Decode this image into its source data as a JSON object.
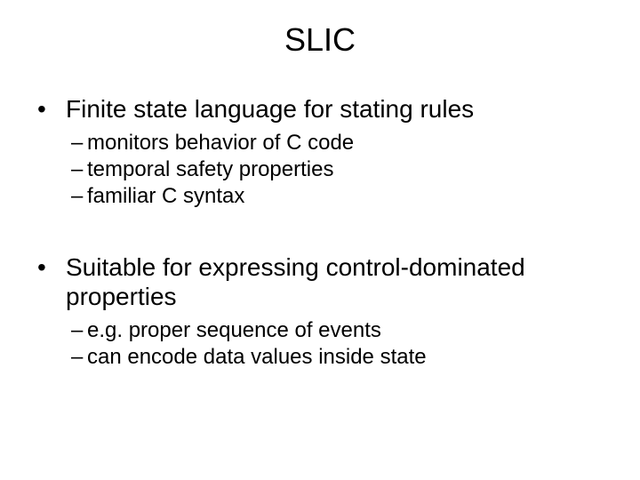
{
  "slide": {
    "title": "SLIC",
    "groups": [
      {
        "heading": "Finite state language for stating rules",
        "items": [
          "monitors behavior of C code",
          "temporal safety properties",
          "familiar C syntax"
        ]
      },
      {
        "heading": "Suitable for expressing control-dominated properties",
        "items": [
          "e.g. proper sequence of events",
          "can encode data values inside state"
        ]
      }
    ]
  },
  "symbols": {
    "bullet": "•",
    "dash": "–"
  }
}
